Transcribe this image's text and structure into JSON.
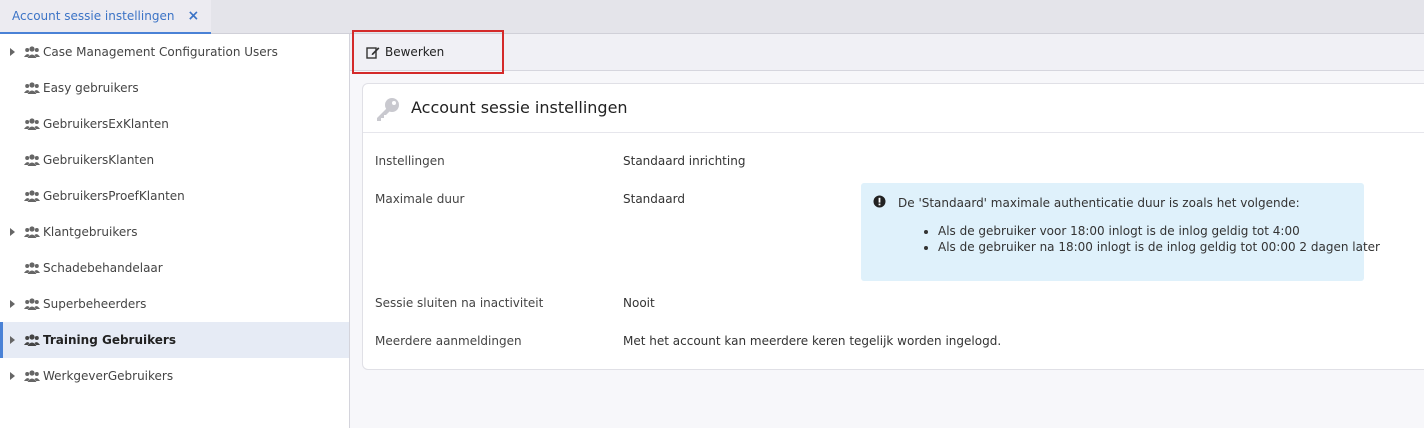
{
  "tab": {
    "label": "Account sessie instellingen",
    "close_glyph": "×"
  },
  "sidebar": {
    "items": [
      {
        "label": "Case Management Configuration Users",
        "expandable": true,
        "selected": false
      },
      {
        "label": "Easy gebruikers",
        "expandable": false,
        "selected": false
      },
      {
        "label": "GebruikersExKlanten",
        "expandable": false,
        "selected": false
      },
      {
        "label": "GebruikersKlanten",
        "expandable": false,
        "selected": false
      },
      {
        "label": "GebruikersProefKlanten",
        "expandable": false,
        "selected": false
      },
      {
        "label": "Klantgebruikers",
        "expandable": true,
        "selected": false
      },
      {
        "label": "Schadebehandelaar",
        "expandable": false,
        "selected": false
      },
      {
        "label": "Superbeheerders",
        "expandable": true,
        "selected": false
      },
      {
        "label": "Training Gebruikers",
        "expandable": true,
        "selected": true
      },
      {
        "label": "WerkgeverGebruikers",
        "expandable": true,
        "selected": false
      }
    ],
    "icon": "users-icon"
  },
  "toolbar": {
    "edit_label": "Bewerken",
    "edit_icon": "edit-icon"
  },
  "card": {
    "title": "Account sessie instellingen",
    "icon": "key-icon",
    "rows": [
      {
        "label": "Instellingen",
        "value": "Standaard inrichting"
      },
      {
        "label": "Maximale duur",
        "value": "Standaard"
      },
      {
        "label": "Sessie sluiten na inactiviteit",
        "value": "Nooit"
      },
      {
        "label": "Meerdere aanmeldingen",
        "value": "Met het account kan meerdere keren tegelijk worden ingelogd."
      }
    ],
    "info": {
      "icon": "exclamation-circle-icon",
      "text": "De 'Standaard' maximale authenticatie duur is zoals het volgende:",
      "bullets": [
        "Als de gebruiker voor 18:00 inlogt is de inlog geldig tot 4:00",
        "Als de gebruiker na 18:00 inlogt is de inlog geldig tot 00:00 2 dagen later"
      ]
    }
  },
  "colors": {
    "accent": "#4a82d6",
    "highlight_border": "#d42a2a",
    "info_background": "#dff1fb",
    "selected_background": "#e6ebf5"
  }
}
